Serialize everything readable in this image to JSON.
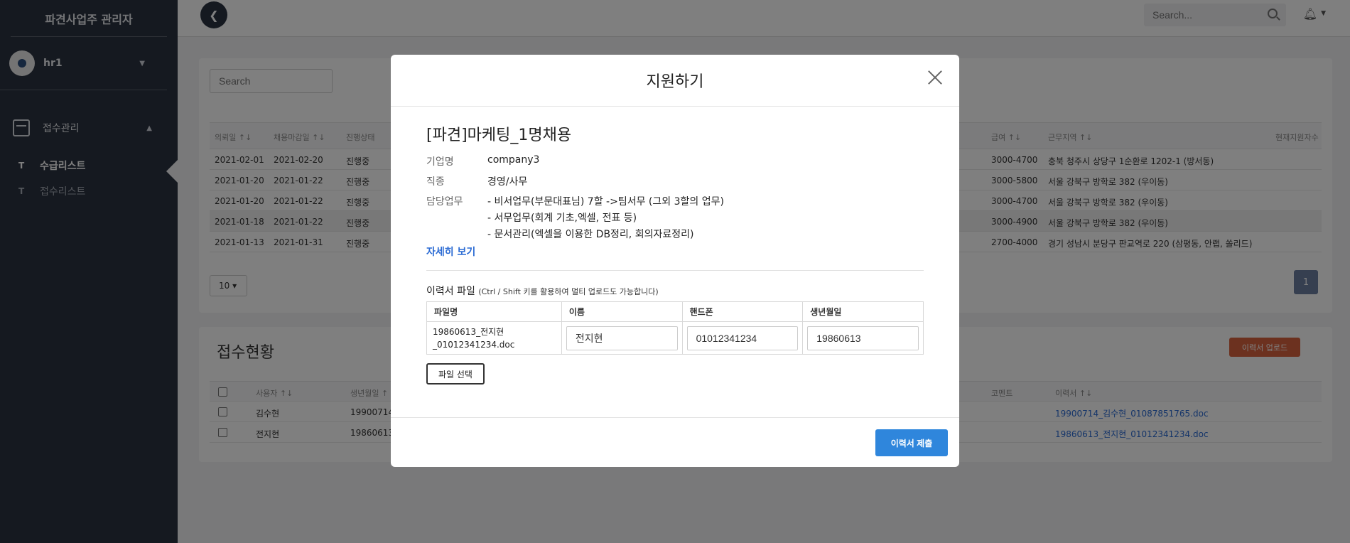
{
  "sidebar": {
    "brand": "파견사업주 관리자",
    "user": {
      "name": "hr1"
    },
    "group": {
      "label": "접수관리"
    },
    "items": [
      {
        "prefix": "T",
        "label": "수급리스트"
      },
      {
        "prefix": "T",
        "label": "접수리스트"
      }
    ]
  },
  "topbar": {
    "search_placeholder": "Search..."
  },
  "list_card": {
    "search_placeholder": "Search",
    "headers": [
      "의뢰일 ↑↓",
      "채용마감일 ↑↓",
      "진행상태",
      "급여 ↑↓",
      "근무지역 ↑↓",
      "현재지원자수"
    ],
    "rows": [
      {
        "request": "2021-02-01",
        "deadline": "2021-02-20",
        "status": "진행중",
        "pay": "3000-4700",
        "region": "충북 청주시 상당구 1순환로 1202-1 (방서동)"
      },
      {
        "request": "2021-01-20",
        "deadline": "2021-01-22",
        "status": "진행중",
        "pay": "3000-5800",
        "region": "서울 강북구 방학로 382 (우이동)"
      },
      {
        "request": "2021-01-20",
        "deadline": "2021-01-22",
        "status": "진행중",
        "pay": "3000-4700",
        "region": "서울 강북구 방학로 382 (우이동)"
      },
      {
        "request": "2021-01-18",
        "deadline": "2021-01-22",
        "status": "진행중",
        "pay": "3000-4900",
        "region": "서울 강북구 방학로 382 (우이동)"
      },
      {
        "request": "2021-01-13",
        "deadline": "2021-01-31",
        "status": "진행중",
        "pay": "2700-4000",
        "region": "경기 성남시 분당구 판교역로 220 (삼평동, 안랩, 쏠리드)"
      }
    ],
    "page_size": "10",
    "page": "1"
  },
  "status_card": {
    "title": "접수현황",
    "upload_label": "이력서 업로드",
    "headers": [
      "사용자 ↑↓",
      "생년월일 ↑",
      "코멘트",
      "이력서 ↑↓"
    ],
    "rows": [
      {
        "user": "김수현",
        "birth": "19900714",
        "resume": "19900714_김수현_01087851765.doc"
      },
      {
        "user": "전지현",
        "birth": "19860613",
        "resume": "19860613_전지현_01012341234.doc"
      }
    ]
  },
  "modal": {
    "title": "지원하기",
    "job_title": "[파견]마케팅_1명채용",
    "company_label": "기업명",
    "company": "company3",
    "category_label": "직종",
    "category": "경영/사무",
    "duty_label": "담당업무",
    "duties": [
      "- 비서업무(부문대표님) 7할 ->팀서무 (그외 3할의 업무)",
      "- 서무업무(회계 기초,엑셀, 전표 등)",
      "- 문서관리(엑셀을 이용한 DB정리, 회의자료정리)"
    ],
    "detail_link": "자세히 보기",
    "resume_label": "이력서 파일",
    "resume_hint": "(Ctrl / Shift 키를 활용하여 멀티 업로드도 가능합니다)",
    "table_headers": [
      "파일명",
      "이름",
      "핸드폰",
      "생년월일"
    ],
    "file": {
      "name_line1": "19860613_전지현",
      "name_line2": "_01012341234.doc",
      "name": "전지현",
      "phone": "01012341234",
      "birth": "19860613"
    },
    "file_select_label": "파일 선택",
    "submit_label": "이력서 제출"
  }
}
